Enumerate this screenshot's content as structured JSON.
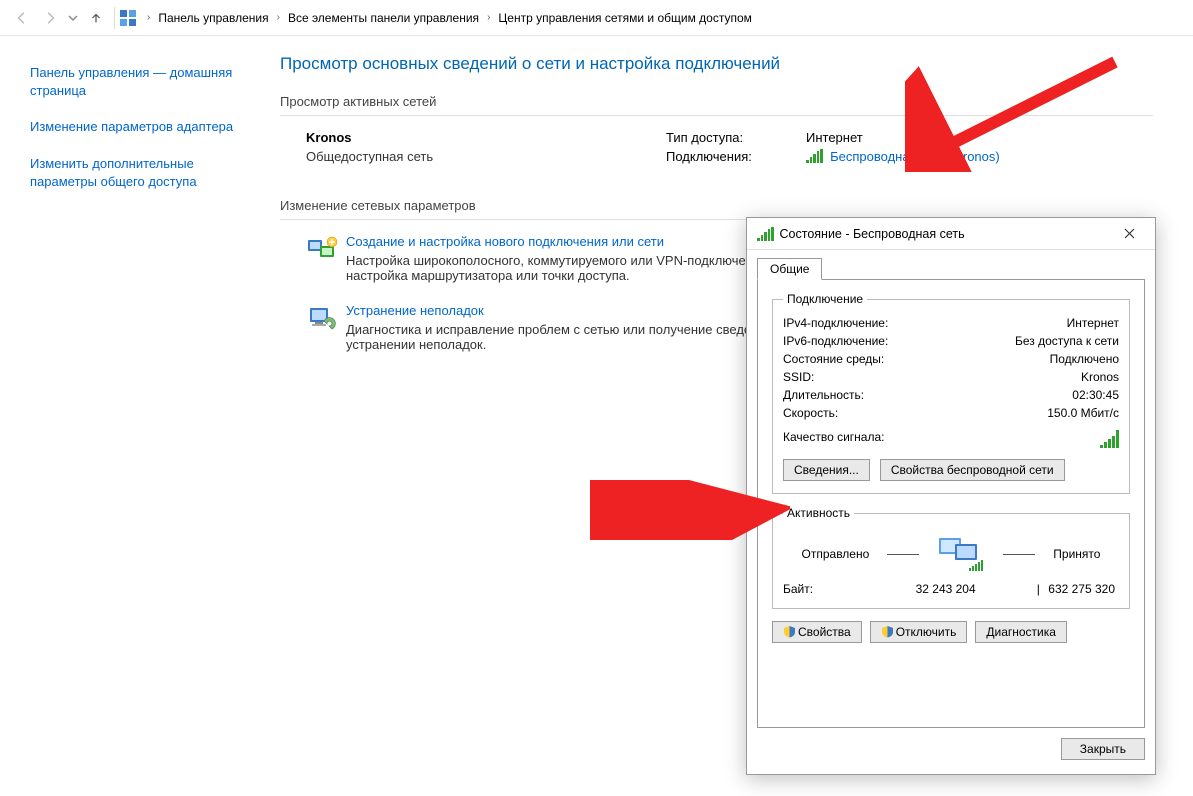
{
  "breadcrumb": {
    "items": [
      "Панель управления",
      "Все элементы панели управления",
      "Центр управления сетями и общим доступом"
    ]
  },
  "sidebar": {
    "links": [
      "Панель управления — домашняя страница",
      "Изменение параметров адаптера",
      "Изменить дополнительные параметры общего доступа"
    ]
  },
  "main": {
    "heading": "Просмотр основных сведений о сети и настройка подключений",
    "active_title": "Просмотр активных сетей",
    "change_title": "Изменение сетевых параметров",
    "network": {
      "name": "Kronos",
      "type": "Общедоступная сеть",
      "access_label": "Тип доступа:",
      "access_value": "Интернет",
      "conn_label": "Подключения:",
      "conn_link": "Беспроводная сеть (Kronos)"
    },
    "items": [
      {
        "title": "Создание и настройка нового подключения или сети",
        "desc": "Настройка широкополосного, коммутируемого или VPN-подключения либо настройка маршрутизатора или точки доступа."
      },
      {
        "title": "Устранение неполадок",
        "desc": "Диагностика и исправление проблем с сетью или получение сведений об устранении неполадок."
      }
    ]
  },
  "dialog": {
    "title": "Состояние - Беспроводная сеть",
    "tab": "Общие",
    "group_conn": "Подключение",
    "group_act": "Активность",
    "rows": {
      "ipv4_k": "IPv4-подключение:",
      "ipv4_v": "Интернет",
      "ipv6_k": "IPv6-подключение:",
      "ipv6_v": "Без доступа к сети",
      "media_k": "Состояние среды:",
      "media_v": "Подключено",
      "ssid_k": "SSID:",
      "ssid_v": "Kronos",
      "dur_k": "Длительность:",
      "dur_v": "02:30:45",
      "speed_k": "Скорость:",
      "speed_v": "150.0 Мбит/с",
      "sig_k": "Качество сигнала:"
    },
    "btn_details": "Сведения...",
    "btn_wprops": "Свойства беспроводной сети",
    "act_sent": "Отправлено",
    "act_recv": "Принято",
    "bytes_label": "Байт:",
    "bytes_sent": "32 243 204",
    "bytes_recv": "632 275 320",
    "btn_props": "Свойства",
    "btn_disable": "Отключить",
    "btn_diag": "Диагностика",
    "btn_close": "Закрыть"
  }
}
